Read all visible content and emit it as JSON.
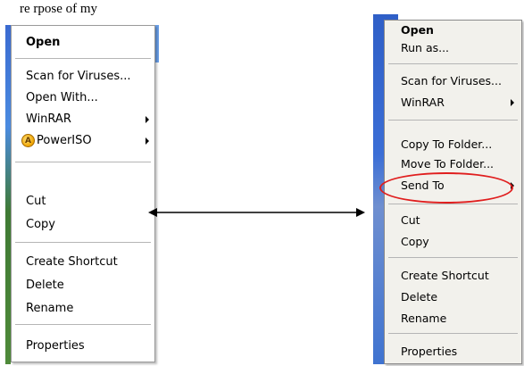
{
  "caption": "re   rpose of my",
  "left_menu": {
    "items": [
      {
        "label": "Open",
        "bold": true
      },
      {
        "label": "Scan for Viruses..."
      },
      {
        "label": "Open With..."
      },
      {
        "label": "WinRAR",
        "submenu": true
      },
      {
        "label": "PowerISO",
        "submenu": true,
        "icon": "poweriso-icon"
      },
      {
        "label": "Cut"
      },
      {
        "label": "Copy"
      },
      {
        "label": "Create Shortcut"
      },
      {
        "label": "Delete"
      },
      {
        "label": "Rename"
      },
      {
        "label": "Properties"
      }
    ]
  },
  "right_menu": {
    "items": [
      {
        "label": "Open",
        "bold": true
      },
      {
        "label": "Run as..."
      },
      {
        "label": "Scan for Viruses..."
      },
      {
        "label": "WinRAR",
        "submenu": true
      },
      {
        "label": "Copy To Folder..."
      },
      {
        "label": "Move To Folder..."
      },
      {
        "label": "Send To",
        "submenu": true,
        "highlighted": true
      },
      {
        "label": "Cut"
      },
      {
        "label": "Copy"
      },
      {
        "label": "Create Shortcut"
      },
      {
        "label": "Delete"
      },
      {
        "label": "Rename"
      },
      {
        "label": "Properties"
      }
    ]
  },
  "colors": {
    "highlight_ellipse": "#e01e1e",
    "desktop_blue": "#3b6ed6"
  }
}
